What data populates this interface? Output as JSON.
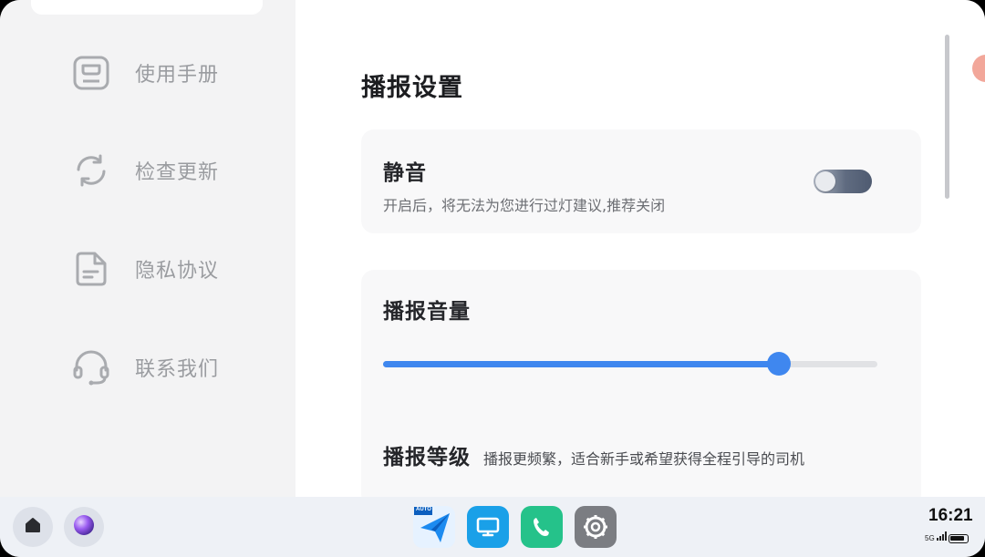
{
  "sidebar": {
    "items": [
      {
        "label": "使用手册",
        "icon": "manual-icon"
      },
      {
        "label": "检查更新",
        "icon": "refresh-icon"
      },
      {
        "label": "隐私协议",
        "icon": "document-icon"
      },
      {
        "label": "联系我们",
        "icon": "headset-icon"
      }
    ]
  },
  "main": {
    "title": "播报设置",
    "mute": {
      "title": "静音",
      "description": "开启后，将无法为您进行过灯建议,推荐关闭",
      "enabled": true
    },
    "volume": {
      "title": "播报音量",
      "level": 0.8
    },
    "broadcast_level": {
      "title": "播报等级",
      "description": "播报更频繁，适合新手或希望获得全程引导的司机"
    }
  },
  "dock": {
    "apps": [
      {
        "name": "navigation-app-icon",
        "badge": "AUTO"
      },
      {
        "name": "screen-app-icon"
      },
      {
        "name": "phone-app-icon"
      },
      {
        "name": "settings-app-icon"
      }
    ],
    "status": {
      "time": "16:21",
      "network": "5G",
      "battery_level": 0.9
    }
  },
  "colors": {
    "accent": "#3f87ef",
    "sidebar_bg": "#f3f3f4",
    "card_bg": "#f8f8f9",
    "dock_bg": "#eef1f6"
  }
}
